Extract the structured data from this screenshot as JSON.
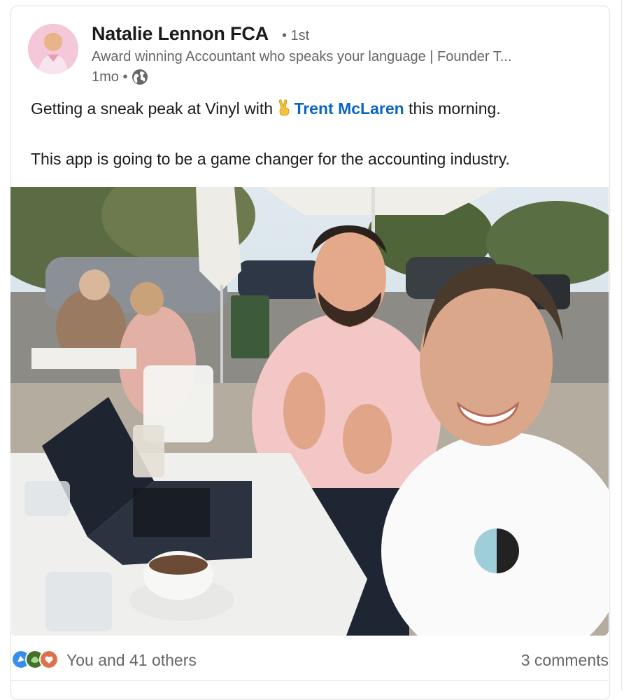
{
  "post": {
    "author": {
      "name": "Natalie Lennon FCA",
      "degree": "• 1st",
      "headline": "Award winning Accountant who speaks your language | Founder T...",
      "time": "1mo •",
      "visibility_icon": "globe-icon",
      "avatar_icon": "avatar"
    },
    "text": {
      "line1_prefix": "Getting a sneak peak at Vinyl with ",
      "emoji": "✌️",
      "mention": "Trent McLaren",
      "line1_suffix": " this morning.",
      "line2": "This app is going to be a game changer for the accounting industry."
    },
    "social": {
      "reaction_icons": [
        "celebrate-icon",
        "insightful-icon",
        "love-icon"
      ],
      "reactions_text": "You and 41 others",
      "comments_text": "3 comments"
    },
    "colors": {
      "mention": "#0a66c2",
      "muted_text": "#666666",
      "border": "#e3e3e3"
    }
  }
}
